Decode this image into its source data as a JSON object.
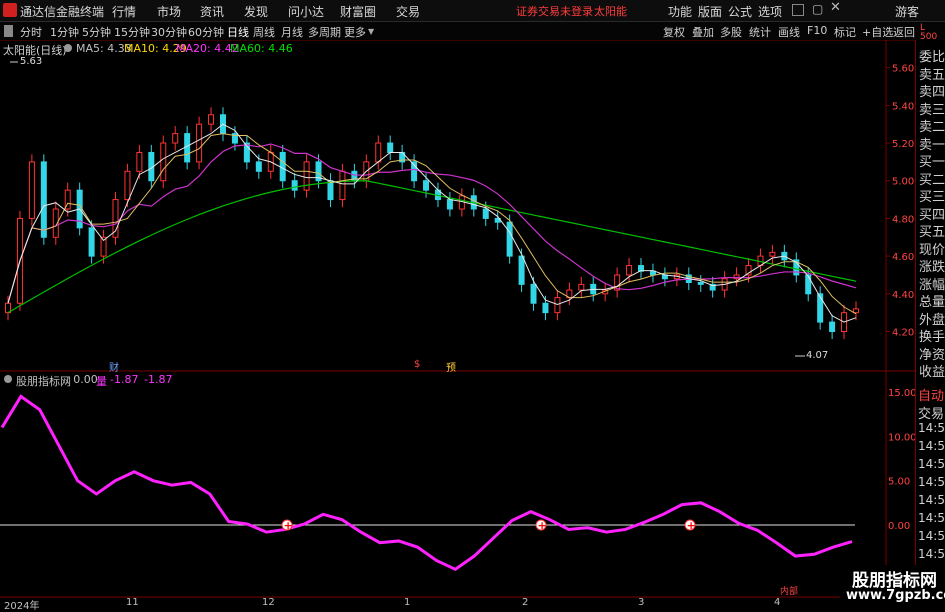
{
  "topbar": {
    "app_name": "通达信金融终端",
    "menus": [
      "行情",
      "市场",
      "资讯",
      "发现",
      "问小达",
      "财富圈",
      "交易"
    ],
    "warning": "证券交易未登录",
    "stock_name_top": "太阳能",
    "right_menus": [
      "功能",
      "版面",
      "公式",
      "选项"
    ],
    "guest": "游客"
  },
  "toolbar": {
    "periods": [
      "分时",
      "1分钟",
      "5分钟",
      "15分钟",
      "30分钟",
      "60分钟",
      "日线",
      "周线",
      "月线",
      "多周期",
      "更多"
    ],
    "selected": "日线",
    "right_buttons": [
      "复权",
      "叠加",
      "多股",
      "统计",
      "画线",
      "F10",
      "标记",
      "+自选",
      "返回"
    ]
  },
  "main_chart": {
    "title": "太阳能(日线)",
    "ma_labels": [
      {
        "text": "MA5: 4.33",
        "color": "#ffffff"
      },
      {
        "text": "MA10: 4.29",
        "color": "#ffd700"
      },
      {
        "text": "MA20: 4.42",
        "color": "#ff33ff"
      },
      {
        "text": "MA60: 4.46",
        "color": "#00e000"
      }
    ],
    "high_label": "5.63",
    "low_label": "4.07",
    "price_ticks": [
      "5.60",
      "5.40",
      "5.20",
      "5.00",
      "4.80",
      "4.60",
      "4.40",
      "4.20"
    ]
  },
  "indicator": {
    "title": "股朋指标网",
    "value": ": 0.00",
    "mark": "量",
    "values": [
      "-1.87",
      "-1.87"
    ],
    "ticks": [
      "15.00",
      "10.00",
      "5.00",
      "0.00"
    ]
  },
  "dates": [
    "2024年",
    "11",
    "12",
    "1",
    "2",
    "3",
    "4"
  ],
  "right_panel": {
    "items": [
      "委比",
      "卖五",
      "卖四",
      "卖三",
      "卖二",
      "卖一",
      "买一",
      "买二",
      "买三",
      "买四",
      "买五",
      "现价",
      "涨跌",
      "涨幅",
      "总量",
      "外盘",
      "换手",
      "净资",
      "收益"
    ],
    "auto": "自动",
    "trade": "交易",
    "times": [
      "14:56",
      "14:56",
      "14:56",
      "14:56",
      "14:56",
      "14:56",
      "14:56",
      "14:56"
    ],
    "top_label": "L 500"
  },
  "markers": {
    "cai": "财",
    "s": "$",
    "yu": "预"
  },
  "inner_label": "内部",
  "watermark": {
    "name": "股朋指标网",
    "url": "www.7gpzb.com"
  },
  "chart_data": {
    "type": "candlestick",
    "y_range": [
      4.07,
      5.63
    ],
    "indicator_range": [
      -5,
      16
    ],
    "indicator_values": [
      11,
      14.5,
      13,
      9,
      5,
      3.5,
      5,
      6,
      5,
      4.5,
      4.8,
      3.5,
      0.4,
      0.1,
      -0.8,
      -0.5,
      0.1,
      1.2,
      0.6,
      -0.8,
      -2,
      -1.8,
      -2.5,
      -4,
      -5,
      -3.5,
      -1.5,
      0.5,
      1.5,
      0.6,
      -0.5,
      -0.3,
      -0.8,
      -0.5,
      0.3,
      1.2,
      2.3,
      2.5,
      1.5,
      0.2,
      -0.6,
      -2,
      -3.5,
      -3.3,
      -2.5,
      -1.87
    ]
  }
}
